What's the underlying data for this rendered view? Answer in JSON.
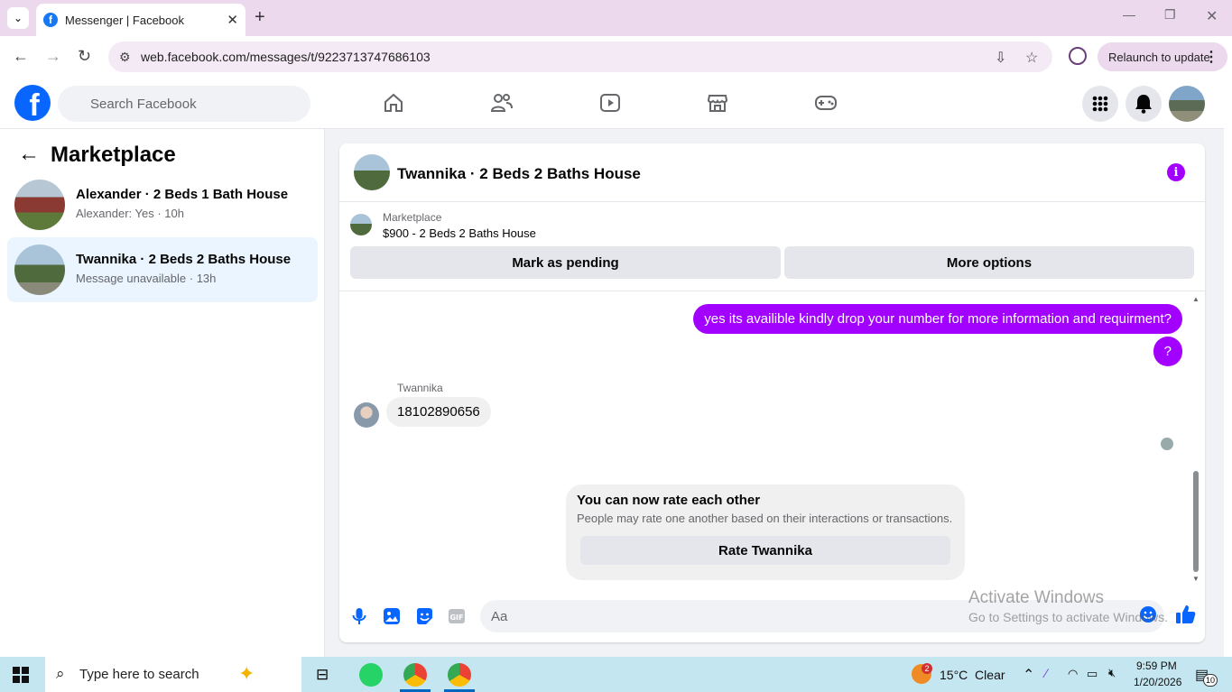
{
  "browser": {
    "tab_title": "Messenger | Facebook",
    "url": "web.facebook.com/messages/t/9223713747686103",
    "relaunch_label": "Relaunch to update"
  },
  "facebook": {
    "search_placeholder": "Search Facebook",
    "logo_letter": "f"
  },
  "sidebar": {
    "title": "Marketplace",
    "conversations": [
      {
        "name": "Alexander · 2 Beds 1 Bath House",
        "preview": "Alexander: Yes · 10h",
        "active": false
      },
      {
        "name": "Twannika · 2 Beds 2 Baths House",
        "preview": "Message unavailable · 13h",
        "active": true
      }
    ]
  },
  "chat": {
    "title": "Twannika · 2 Beds 2 Baths House",
    "marketplace_label": "Marketplace",
    "listing": "$900 - 2 Beds 2 Baths House",
    "mark_pending_label": "Mark as pending",
    "more_options_label": "More options",
    "messages": {
      "out_1": "yes its availible kindly drop your number for more information and requirment?",
      "out_2": "?",
      "sender": "Twannika",
      "in_1": "18102890656"
    },
    "rating": {
      "title": "You can now rate each other",
      "subtitle": "People may rate one another based on their interactions or transactions.",
      "button": "Rate Twannika"
    },
    "composer_placeholder": "Aa",
    "accent_color": "#a200ff"
  },
  "watermark": {
    "line1": "Activate Windows",
    "line2": "Go to Settings to activate Windows."
  },
  "taskbar": {
    "search_placeholder": "Type here to search",
    "weather": "15°C  Clear",
    "weather_badge": "2",
    "time": "9:59 PM",
    "date": "1/20/2026",
    "notification_count": "10"
  }
}
